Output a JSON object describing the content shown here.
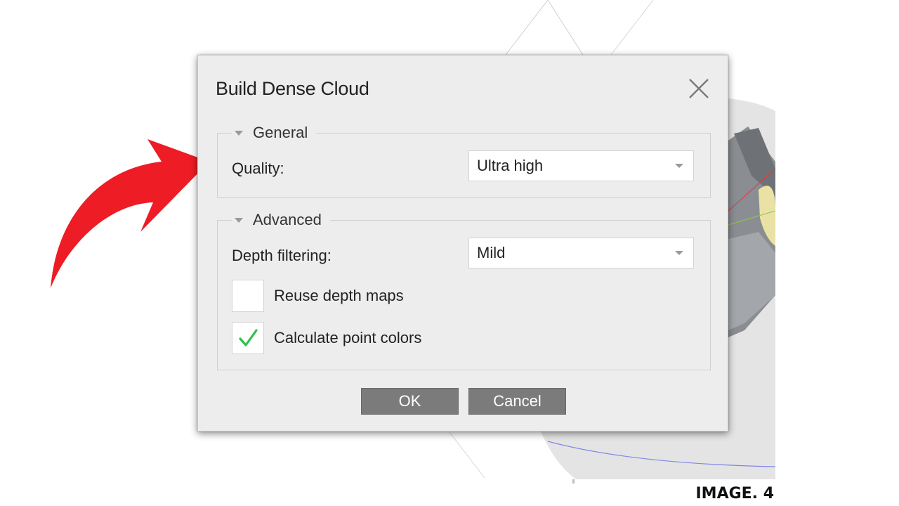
{
  "dialog": {
    "title": "Build Dense Cloud",
    "close_icon": "close-icon"
  },
  "general": {
    "header": "General",
    "quality_label": "Quality:",
    "quality_value": "Ultra high"
  },
  "advanced": {
    "header": "Advanced",
    "depth_filtering_label": "Depth filtering:",
    "depth_filtering_value": "Mild",
    "reuse_depth_maps_label": "Reuse depth maps",
    "reuse_depth_maps_checked": false,
    "calculate_point_colors_label": "Calculate point colors",
    "calculate_point_colors_checked": true
  },
  "buttons": {
    "ok": "OK",
    "cancel": "Cancel"
  },
  "caption": "IMAGE. 4",
  "colors": {
    "button_bg": "#7b7b7b",
    "check_green": "#2fbf4f",
    "arrow_red": "#ee1c24"
  }
}
